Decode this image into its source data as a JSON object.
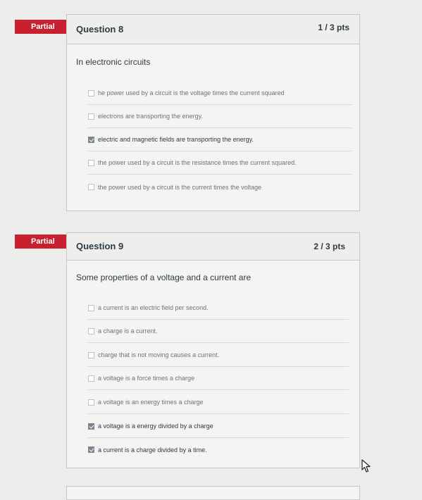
{
  "questions": [
    {
      "badge": "Partial",
      "title": "Question 8",
      "points": "1 / 3 pts",
      "text": "In electronic circuits",
      "answers": [
        {
          "label": "he power used by a circuit is the voltage times the current squared",
          "checked": false
        },
        {
          "label": "electrons are transporting the energy.",
          "checked": false
        },
        {
          "label": "electric and magnetic fields are transporting the energy.",
          "checked": true
        },
        {
          "label": "the power used by a circuit is the resistance times the current squared.",
          "checked": false
        },
        {
          "label": "the power used by a circuit is the current times the voltage",
          "checked": false
        }
      ]
    },
    {
      "badge": "Partial",
      "title": "Question 9",
      "points": "2 / 3 pts",
      "text": "Some properties of a voltage and a current are",
      "answers": [
        {
          "label": "a current is an electric field per second.",
          "checked": false
        },
        {
          "label": "a charge is a current.",
          "checked": false
        },
        {
          "label": "charge that is not moving causes a current.",
          "checked": false
        },
        {
          "label": "a voltage is a force times a charge",
          "checked": false
        },
        {
          "label": "a voltage is an energy times a charge",
          "checked": false
        },
        {
          "label": "a voltage is a energy divided by a charge",
          "checked": true
        },
        {
          "label": "a current is a charge divided by a time.",
          "checked": true
        }
      ]
    }
  ]
}
